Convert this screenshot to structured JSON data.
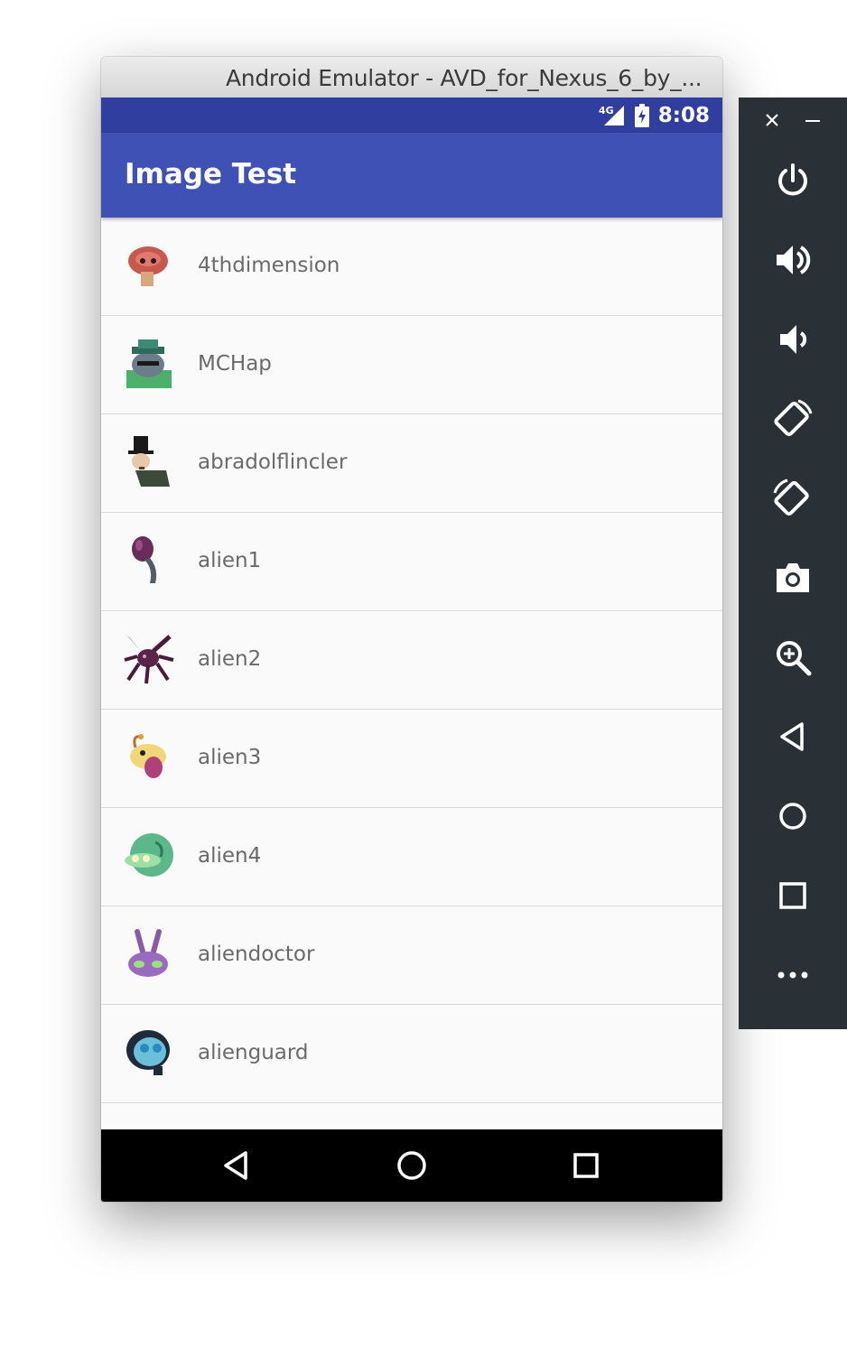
{
  "window": {
    "title": "Android Emulator - AVD_for_Nexus_6_by_..."
  },
  "status_bar": {
    "network": "4G",
    "time": "8:08"
  },
  "app_bar": {
    "title": "Image Test"
  },
  "list": {
    "items": [
      {
        "label": "4thdimension",
        "icon": "red-creature-avatar"
      },
      {
        "label": "MCHap",
        "icon": "green-hat-creature-avatar"
      },
      {
        "label": "abradolflincler",
        "icon": "top-hat-man-avatar"
      },
      {
        "label": "alien1",
        "icon": "purple-alien-avatar"
      },
      {
        "label": "alien2",
        "icon": "spiky-alien-avatar"
      },
      {
        "label": "alien3",
        "icon": "yellow-alien-avatar"
      },
      {
        "label": "alien4",
        "icon": "green-blob-alien-avatar"
      },
      {
        "label": "aliendoctor",
        "icon": "purple-doctor-alien-avatar"
      },
      {
        "label": "alienguard",
        "icon": "blue-guard-alien-avatar"
      }
    ]
  },
  "nav_bar": {
    "buttons": [
      "back-icon",
      "home-icon",
      "recents-icon"
    ]
  },
  "emulator_toolbar": {
    "buttons": [
      "close-icon",
      "minimize-icon",
      "power-icon",
      "volume-up-icon",
      "volume-down-icon",
      "rotate-left-icon",
      "rotate-right-icon",
      "camera-icon",
      "zoom-icon",
      "back-icon",
      "home-icon",
      "overview-icon",
      "more-icon"
    ]
  },
  "colors": {
    "status_bar": "#303f9f",
    "app_bar": "#3f51b5",
    "toolbar": "#2a3136"
  }
}
